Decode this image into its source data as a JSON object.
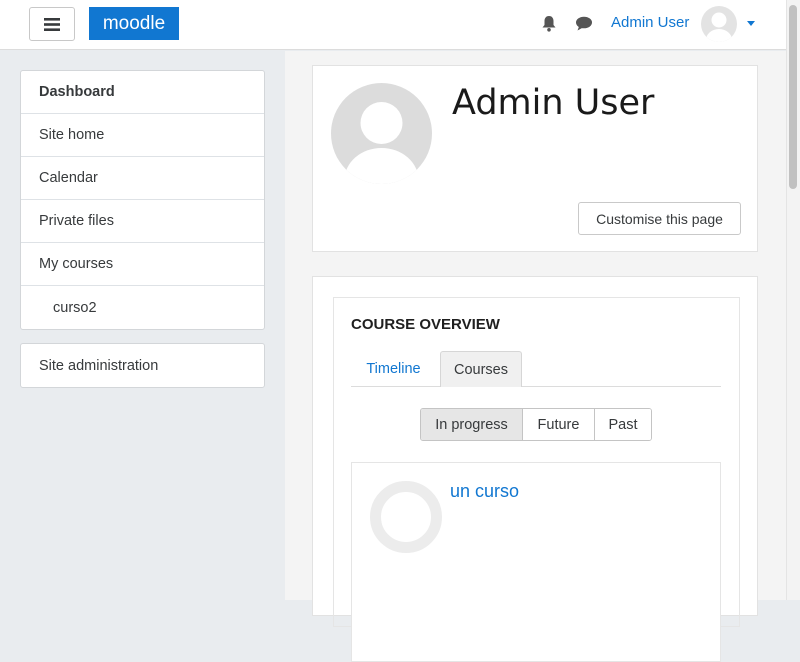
{
  "navbar": {
    "logo": "moodle",
    "user_name": "Admin User",
    "icons": {
      "menu": "menu-icon",
      "notifications": "bell-icon",
      "messages": "chat-icon",
      "dropdown": "caret-down-icon"
    },
    "accent": "#1177d1"
  },
  "sidebar": {
    "items": [
      {
        "label": "Dashboard"
      },
      {
        "label": "Site home"
      },
      {
        "label": "Calendar"
      },
      {
        "label": "Private files"
      },
      {
        "label": "My courses"
      },
      {
        "label": "curso2"
      }
    ],
    "admin_label": "Site administration"
  },
  "header": {
    "name": "Admin User",
    "customise_label": "Customise this page"
  },
  "overview": {
    "title": "COURSE OVERVIEW",
    "tabs": [
      {
        "label": "Timeline"
      },
      {
        "label": "Courses"
      }
    ],
    "filters": [
      {
        "label": "In progress"
      },
      {
        "label": "Future"
      },
      {
        "label": "Past"
      }
    ],
    "course": {
      "name": "un curso",
      "progress": "0%"
    }
  }
}
